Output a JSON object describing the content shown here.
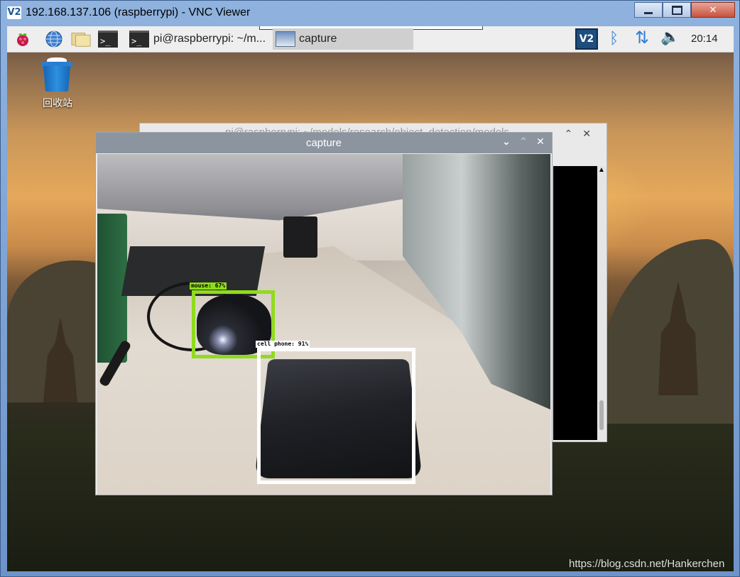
{
  "vnc": {
    "app_icon": "V2",
    "title": "192.168.137.106 (raspberrypi) - VNC Viewer"
  },
  "taskbar": {
    "tasks": [
      {
        "label": "pi@raspberrypi: ~/m..."
      },
      {
        "label": "capture"
      }
    ],
    "tray": {
      "vnc_icon_text": "V2",
      "clock": "20:14"
    }
  },
  "desktop": {
    "trash_label": "回收站"
  },
  "terminal_window": {
    "title": "pi@raspberrypi: ~/models/research/object_detection/models"
  },
  "capture_window": {
    "title": "capture",
    "detections": [
      {
        "label": "mouse: 67%",
        "color": "#8fdc1c"
      },
      {
        "label": "cell phone: 91%",
        "color": "#ffffff"
      }
    ]
  },
  "watermark": "https://blog.csdn.net/Hankerchen"
}
